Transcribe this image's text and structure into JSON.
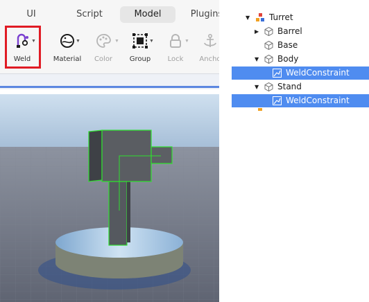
{
  "tabs": [
    {
      "label": "UI"
    },
    {
      "label": "Script"
    },
    {
      "label": "Model"
    },
    {
      "label": "Plugins"
    }
  ],
  "toolbar": {
    "tools": [
      {
        "label": "Weld",
        "icon": "weld-icon"
      },
      {
        "label": "Material",
        "icon": "material-icon"
      },
      {
        "label": "Color",
        "icon": "color-icon"
      },
      {
        "label": "Group",
        "icon": "group-icon"
      },
      {
        "label": "Lock",
        "icon": "lock-icon"
      },
      {
        "label": "Ancho",
        "icon": "anchor-icon"
      }
    ]
  },
  "explorer": {
    "items": [
      {
        "label": "Turret",
        "icon": "model-icon"
      },
      {
        "label": "Barrel",
        "icon": "part-icon"
      },
      {
        "label": "Base",
        "icon": "part-icon"
      },
      {
        "label": "Body",
        "icon": "part-icon"
      },
      {
        "label": "WeldConstraint",
        "icon": "weld-constraint-icon"
      },
      {
        "label": "Stand",
        "icon": "part-icon"
      },
      {
        "label": "WeldConstraint",
        "icon": "weld-constraint-icon"
      }
    ]
  },
  "colors": {
    "selection": "#4f8cf0",
    "highlight_box": "#e01b24",
    "selection_outline": "#2fe02f"
  }
}
